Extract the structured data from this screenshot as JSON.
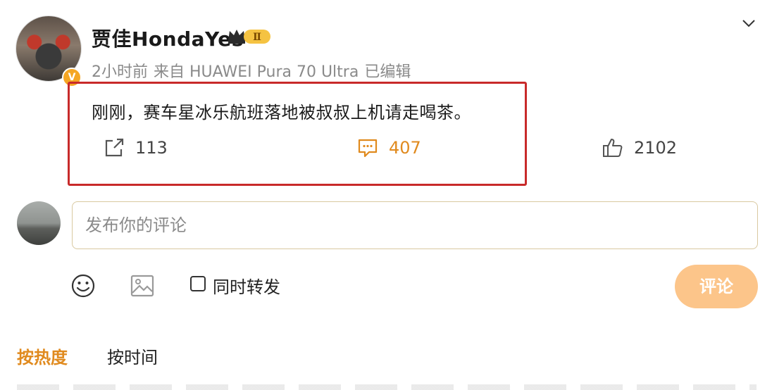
{
  "post": {
    "username": "贾佳HondaYes",
    "vip_level": "Ⅱ",
    "verified_mark": "V",
    "time": "2小时前",
    "source": "来自 HUAWEI Pura 70 Ultra",
    "edited": "已编辑",
    "text": "刚刚，赛车星冰乐航班落地被叔叔上机请走喝茶。",
    "stats": {
      "share_count": "113",
      "comment_count": "407",
      "like_count": "2102"
    },
    "icons": {
      "share": "share-icon",
      "comment": "comment-icon",
      "like": "thumbs-up-icon",
      "menu": "chevron-down-icon"
    }
  },
  "composer": {
    "placeholder": "发布你的评论",
    "value": "",
    "repost_label": "同时转发",
    "repost_checked": false,
    "submit_label": "评论",
    "icons": {
      "emoji": "emoji-icon",
      "image": "image-icon"
    }
  },
  "sort_tabs": {
    "hot_label": "按热度",
    "time_label": "按时间",
    "active": "hot"
  },
  "colors": {
    "accent": "#e08a1e",
    "highlight_border": "#c82a2a",
    "submit_disabled": "#fcc58a",
    "muted_text": "#8a8a8a"
  }
}
